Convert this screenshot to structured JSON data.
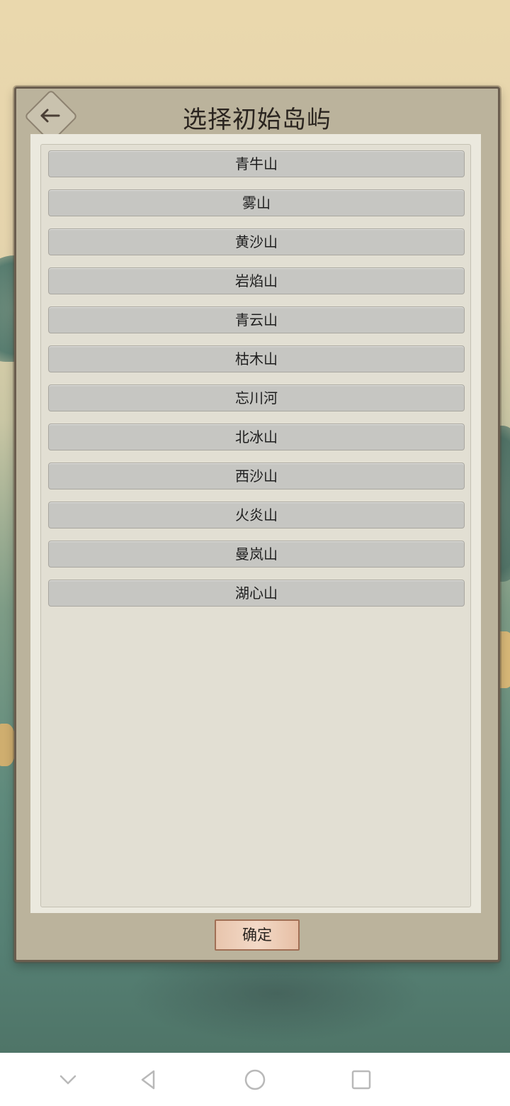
{
  "dialog": {
    "title": "选择初始岛屿",
    "back_icon": "back-arrow-icon",
    "confirm_label": "确定"
  },
  "islands": [
    "青牛山",
    "雾山",
    "黄沙山",
    "岩焰山",
    "青云山",
    "枯木山",
    "忘川河",
    "北冰山",
    "西沙山",
    "火炎山",
    "曼岚山",
    "湖心山"
  ],
  "nav": {
    "icons": [
      "chevron-down-icon",
      "back-triangle-icon",
      "home-circle-icon",
      "recents-square-icon"
    ]
  },
  "colors": {
    "panel": "#bbb39c",
    "list_bg": "#ebe9de",
    "item_bg": "#c6c6c2",
    "confirm_bg": "#f3d9c7",
    "border": "#6a5d4e"
  }
}
